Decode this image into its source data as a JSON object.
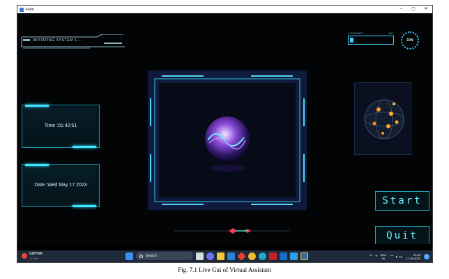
{
  "window": {
    "title": "Form",
    "minimize": "–",
    "maximize": "▢",
    "close": "✕"
  },
  "hud": {
    "init_text": "INITIATING SYSTEM 1....",
    "loading_label": "LOADING...",
    "loading_pct": "100",
    "loading_value": 0.08,
    "ring_text": "10N",
    "time_text": "Time :01:42:51",
    "date_text": "Date :Wed May 17 2023",
    "start_label": "Start",
    "quit_label": "Quit"
  },
  "colors": {
    "accent": "#3fe6ff",
    "background": "#020406",
    "center_bg": "#101a3c"
  },
  "taskbar": {
    "weather_symbol": "GBPINR",
    "weather_change": "-0.13%",
    "search_placeholder": "Search",
    "lang_top": "ENG",
    "lang_bottom": "IN",
    "clock_time": "01:42",
    "clock_date": "17-05-2023",
    "notif_count": "1",
    "tray_chevron": "^",
    "tray_icons": "⌔ ◑ ▭",
    "app_icons": [
      "start-icon",
      "search-icon",
      "task-view-icon",
      "chat-icon",
      "file-explorer-icon",
      "mail-icon",
      "red-app-icon",
      "chrome-icon",
      "edge-icon",
      "mcafee-icon",
      "outlook-icon",
      "vscode-icon",
      "python-icon"
    ]
  },
  "caption": "Fig. 7.1 Live Gui of Virtual Assistant"
}
